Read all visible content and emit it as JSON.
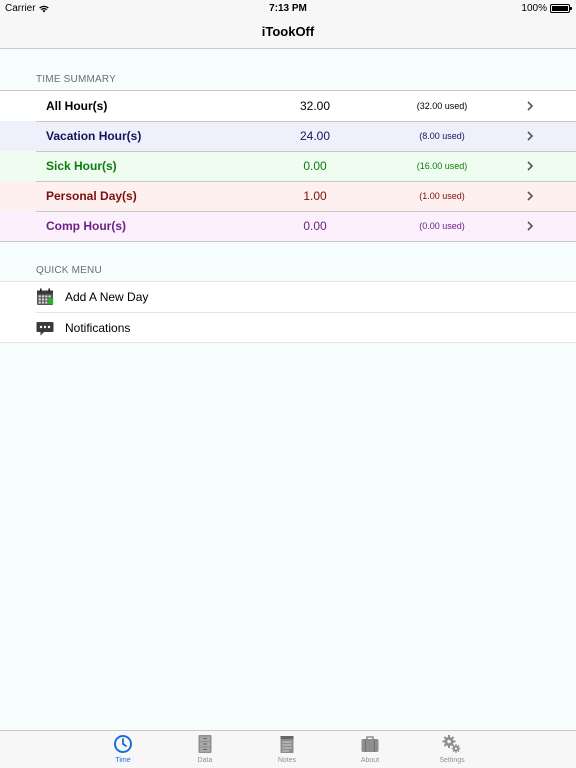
{
  "status_bar": {
    "carrier": "Carrier",
    "time": "7:13 PM",
    "battery": "100%"
  },
  "nav": {
    "title": "iTookOff"
  },
  "time_summary": {
    "header": "TIME SUMMARY",
    "rows": [
      {
        "label": "All Hour(s)",
        "hours": "32.00",
        "used": "(32.00 used)",
        "color": "#000000",
        "bg": "#ffffff"
      },
      {
        "label": "Vacation Hour(s)",
        "hours": "24.00",
        "used": "(8.00 used)",
        "color": "#14145a",
        "bg": "#eef1fc"
      },
      {
        "label": "Sick Hour(s)",
        "hours": "0.00",
        "used": "(16.00 used)",
        "color": "#0e7a0e",
        "bg": "#effdf0"
      },
      {
        "label": "Personal Day(s)",
        "hours": "1.00",
        "used": "(1.00 used)",
        "color": "#7b0f0f",
        "bg": "#fdf0ee"
      },
      {
        "label": "Comp Hour(s)",
        "hours": "0.00",
        "used": "(0.00 used)",
        "color": "#6b2384",
        "bg": "#fbf0fb"
      }
    ]
  },
  "quick_menu": {
    "header": "QUICK MENU",
    "items": [
      {
        "label": "Add A New Day",
        "icon": "calendar-icon"
      },
      {
        "label": "Notifications",
        "icon": "chat-bubble-icon"
      }
    ]
  },
  "tabs": [
    {
      "label": "Time",
      "icon": "clock-icon",
      "active": true
    },
    {
      "label": "Data",
      "icon": "cabinet-icon",
      "active": false
    },
    {
      "label": "Notes",
      "icon": "notepad-icon",
      "active": false
    },
    {
      "label": "About",
      "icon": "briefcase-icon",
      "active": false
    },
    {
      "label": "Settings",
      "icon": "gears-icon",
      "active": false
    }
  ],
  "colors": {
    "active_tab": "#1a6fd6",
    "inactive_tab": "#929292",
    "background": "#f5fefd"
  }
}
